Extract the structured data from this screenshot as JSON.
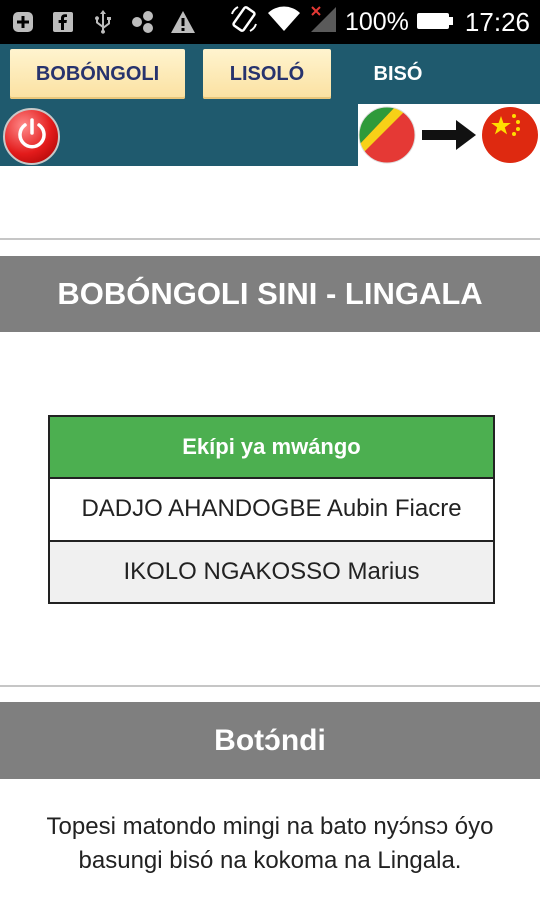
{
  "status_bar": {
    "battery_percent": "100%",
    "time": "17:26",
    "icons": [
      "plus-icon",
      "facebook-icon",
      "usb-icon",
      "share-icon",
      "warning-icon",
      "rotate-icon",
      "wifi-icon",
      "signal-icon",
      "battery-icon"
    ]
  },
  "tabs": [
    {
      "label": "BOBÓNGOLI",
      "active": false
    },
    {
      "label": "LISOLÓ",
      "active": false
    },
    {
      "label": "BISÓ",
      "active": true
    }
  ],
  "toolbar": {
    "power_icon": "power-icon",
    "flags": [
      "congo-flag",
      "china-flag"
    ]
  },
  "section1": {
    "title": "BOBÓNGOLI SINI - LINGALA"
  },
  "team_table": {
    "header": "Ekípi ya mwángo",
    "rows": [
      "DADJO AHANDOGBE Aubin Fiacre",
      "IKOLO NGAKOSSO Marius"
    ]
  },
  "section2": {
    "title": "Botɔ́ndi"
  },
  "thanks_text": "Topesi matondo mingi na bato nyɔ́nsɔ óyo basungi bisó na kokoma na Lingala.",
  "colors": {
    "toolbar": "#1f5a6e",
    "tab_inactive": "#fbe1a1",
    "table_header": "#4caf50",
    "section_header": "#7f7f7f",
    "power": "#e31b1b"
  }
}
